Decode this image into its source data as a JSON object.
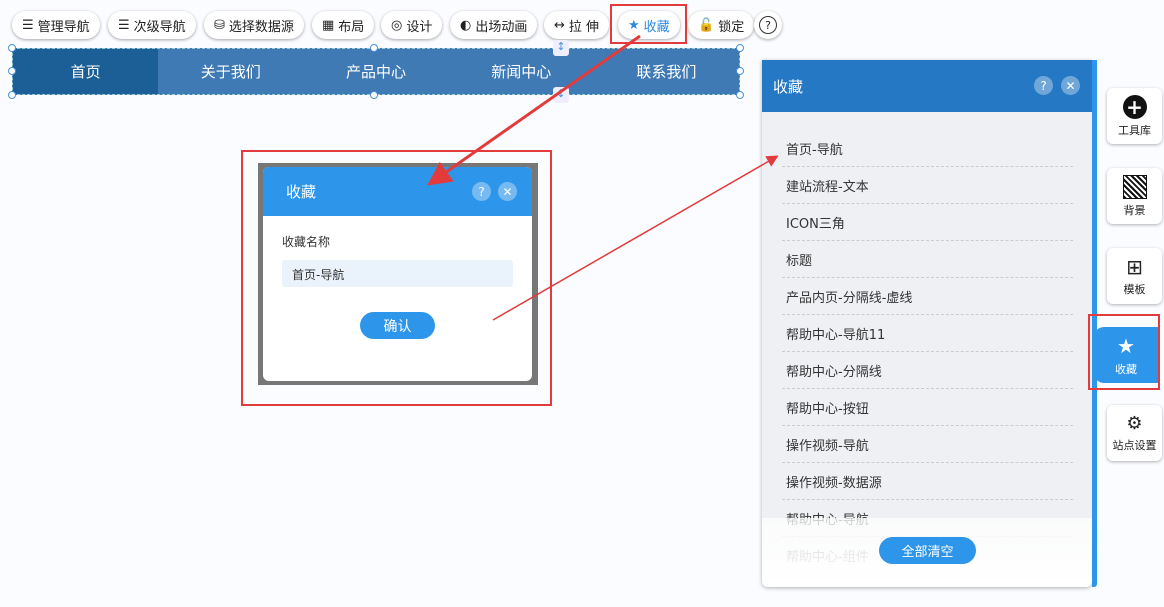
{
  "toolbar": [
    {
      "label": "管理导航",
      "icon": "list-icon"
    },
    {
      "label": "次级导航",
      "icon": "sub-nav-icon"
    },
    {
      "label": "选择数据源",
      "icon": "database-icon"
    },
    {
      "label": "布局",
      "icon": "layout-icon"
    },
    {
      "label": "设计",
      "icon": "design-icon"
    },
    {
      "label": "出场动画",
      "icon": "animation-icon"
    },
    {
      "label": "拉 伸",
      "icon": "stretch-icon"
    },
    {
      "label": "收藏",
      "icon": "star-plus-icon"
    },
    {
      "label": "锁定",
      "icon": "unlock-icon"
    },
    {
      "label": "?",
      "icon": "help-icon"
    }
  ],
  "nav": [
    "首页",
    "关于我们",
    "产品中心",
    "新闻中心",
    "联系我们"
  ],
  "dialog": {
    "title": "收藏",
    "field_label": "收藏名称",
    "field_value": "首页-导航",
    "confirm": "确认",
    "help": "?",
    "close": "✕"
  },
  "panel": {
    "title": "收藏",
    "help": "?",
    "close": "✕",
    "items": [
      "首页-导航",
      "建站流程-文本",
      "ICON三角",
      "标题",
      "产品内页-分隔线-虚线",
      "帮助中心-导航11",
      "帮助中心-分隔线",
      "帮助中心-按钮",
      "操作视频-导航",
      "操作视频-数据源",
      "帮助中心-导航",
      "帮助中心-组件"
    ],
    "clear_all": "全部清空"
  },
  "sidebar": [
    {
      "label": "工具库"
    },
    {
      "label": "背景"
    },
    {
      "label": "模板"
    },
    {
      "label": "收藏"
    },
    {
      "label": "站点设置"
    }
  ],
  "colors": {
    "accent": "#2e96ea",
    "nav": "#3f7ab5",
    "nav_active": "#1c5f96",
    "annotation": "#e33b3b"
  }
}
